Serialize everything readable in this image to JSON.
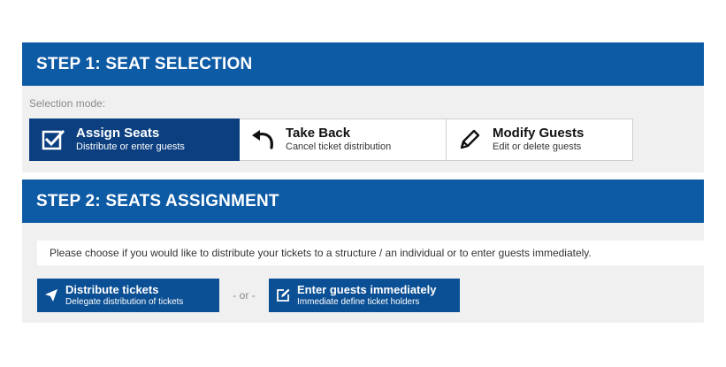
{
  "colors": {
    "header_blue": "#0d5aa5",
    "active_blue": "#0b3f80",
    "button_blue": "#0b4f94",
    "panel_bg": "#f0f0f0"
  },
  "step1": {
    "title": "STEP 1: SEAT SELECTION",
    "mode_label": "Selection mode:",
    "modes": [
      {
        "title": "Assign Seats",
        "subtitle": "Distribute or enter guests",
        "icon": "checkbox-icon",
        "active": true
      },
      {
        "title": "Take Back",
        "subtitle": "Cancel ticket distribution",
        "icon": "undo-arrow-icon",
        "active": false
      },
      {
        "title": "Modify Guests",
        "subtitle": "Edit or delete guests",
        "icon": "pencil-icon",
        "active": false
      }
    ]
  },
  "step2": {
    "title": "STEP 2: SEATS ASSIGNMENT",
    "notice": "Please choose if you would like to distribute your tickets to a structure / an individual or to enter guests immediately.",
    "distribute": {
      "title": "Distribute tickets",
      "subtitle": "Delegate distribution of tickets",
      "icon": "send-icon"
    },
    "or_text": "- or -",
    "enter": {
      "title": "Enter guests immediately",
      "subtitle": "Immediate define ticket holders",
      "icon": "edit-icon"
    }
  }
}
